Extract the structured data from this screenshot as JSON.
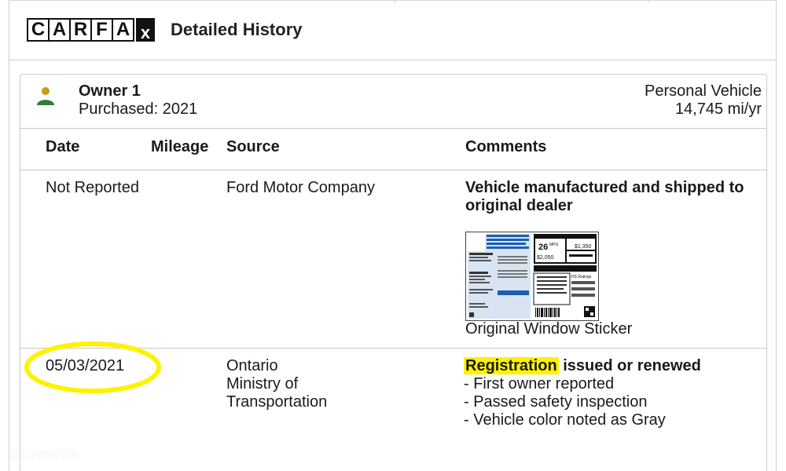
{
  "header": {
    "logo_letters": [
      "C",
      "A",
      "R",
      "F",
      "A"
    ],
    "logo_x": "x",
    "title": "Detailed History"
  },
  "owner": {
    "name": "Owner 1",
    "purchased": "Purchased: 2021",
    "vehicle_type": "Personal Vehicle",
    "mileage_per_year": "14,745 mi/yr",
    "icon": "person-icon",
    "icon_color": "#2e7d32",
    "icon_head_color": "#c79a1f"
  },
  "table": {
    "columns": [
      "Date",
      "Mileage",
      "Source",
      "Comments"
    ],
    "rows": [
      {
        "date": "Not Reported",
        "mileage": "",
        "source": [
          "Ford Motor Company"
        ],
        "comment_title": "Vehicle manufactured and shipped to original dealer",
        "sticker_caption": "Original Window Sticker",
        "sticker": {
          "mpg": "26",
          "mpg_unit": "MPG",
          "price_top": "$1,350",
          "price_left": "$2,050",
          "ratings": "HS Ratings"
        }
      },
      {
        "date": "05/03/2021",
        "mileage": "",
        "source": [
          "Ontario",
          "Ministry of",
          "Transportation"
        ],
        "comment_highlight": "Registration",
        "comment_title_rest": " issued or renewed",
        "comment_items": [
          "- First owner reported",
          "- Passed safety inspection",
          "- Vehicle color noted as Gray"
        ]
      }
    ]
  },
  "colors": {
    "highlight": "#fff200",
    "border": "#c9c9c9"
  },
  "watermark": "otomoto"
}
